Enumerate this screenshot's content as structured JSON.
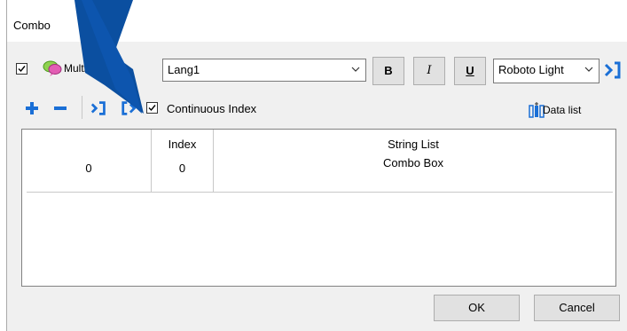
{
  "dialog": {
    "title": "Combo"
  },
  "row1": {
    "multilanguage_checked": true,
    "multilanguage_label": "Multilanguage",
    "language_value": "Lang1",
    "bold_label": "B",
    "italic_label": "I",
    "underline_label": "U",
    "font_value": "Roboto Light"
  },
  "row2": {
    "continuous_index_checked": true,
    "continuous_index_label": "Continuous Index",
    "data_list_label": "Data list"
  },
  "table": {
    "columns": [
      "",
      "Index",
      "String List"
    ],
    "rows": [
      {
        "number": "0",
        "index": "0",
        "string": "Combo Box"
      }
    ]
  },
  "buttons": {
    "ok": "OK",
    "cancel": "Cancel"
  },
  "colors": {
    "accent_blue": "#1a6fd6",
    "pointer_blue": "#0b4fa0"
  }
}
